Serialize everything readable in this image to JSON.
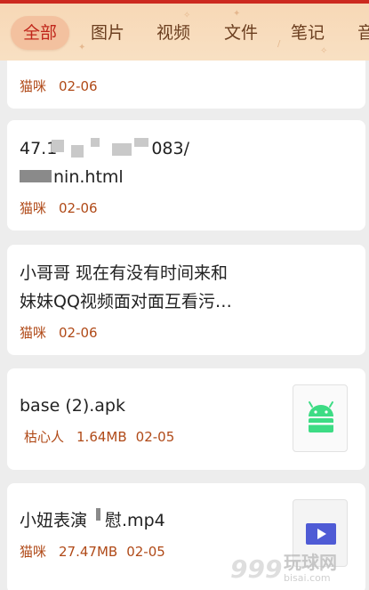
{
  "tabs": [
    {
      "label": "全部",
      "active": true
    },
    {
      "label": "图片",
      "active": false
    },
    {
      "label": "视频",
      "active": false
    },
    {
      "label": "文件",
      "active": false
    },
    {
      "label": "笔记",
      "active": false
    },
    {
      "label": "音",
      "active": false
    }
  ],
  "items": [
    {
      "title_lines": [],
      "sender": "猫咪",
      "date": "02-06",
      "size": ""
    },
    {
      "title_lines": [
        "47.1",
        "083/",
        "nin.html"
      ],
      "sender": "猫咪",
      "date": "02-06",
      "size": ""
    },
    {
      "title_lines": [
        "小哥哥  现在有没有时间来和",
        "妹妹QQ视频面对面互看污…"
      ],
      "sender": "猫咪",
      "date": "02-06",
      "size": ""
    },
    {
      "title_lines": [
        "base (2).apk"
      ],
      "sender": "枯心人",
      "date": "02-05",
      "size": "1.64MB",
      "thumb_icon": "android-icon"
    },
    {
      "title_lines": [
        "小妞表演",
        "慰.mp4"
      ],
      "sender": "猫咪",
      "date": "02-05",
      "size": "27.47MB",
      "thumb_icon": "play-icon"
    }
  ],
  "watermark": {
    "text": "玩球网",
    "latin": "bisai.com",
    "number": "999"
  },
  "colors": {
    "accent": "#c0261b",
    "meta": "#b04a18",
    "tabbar_bg": "#f8dcbc",
    "android_green": "#3ddc84",
    "play_blue": "#4f5bd5"
  }
}
